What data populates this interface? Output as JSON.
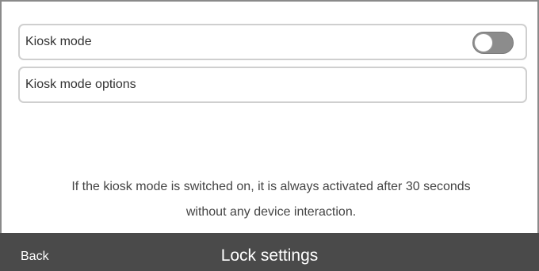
{
  "settings": {
    "items": [
      {
        "label": "Kiosk mode",
        "toggle_on": false
      },
      {
        "label": "Kiosk mode options"
      }
    ],
    "info_line1": "If the kiosk mode is switched on, it is always activated after 30 seconds",
    "info_line2": "without any device interaction."
  },
  "footer": {
    "back_label": "Back",
    "title": "Lock settings"
  },
  "colors": {
    "footer_bg": "#4a4a4a",
    "toggle_off": "#8c8c8c",
    "row_border": "#cfcfcf"
  }
}
